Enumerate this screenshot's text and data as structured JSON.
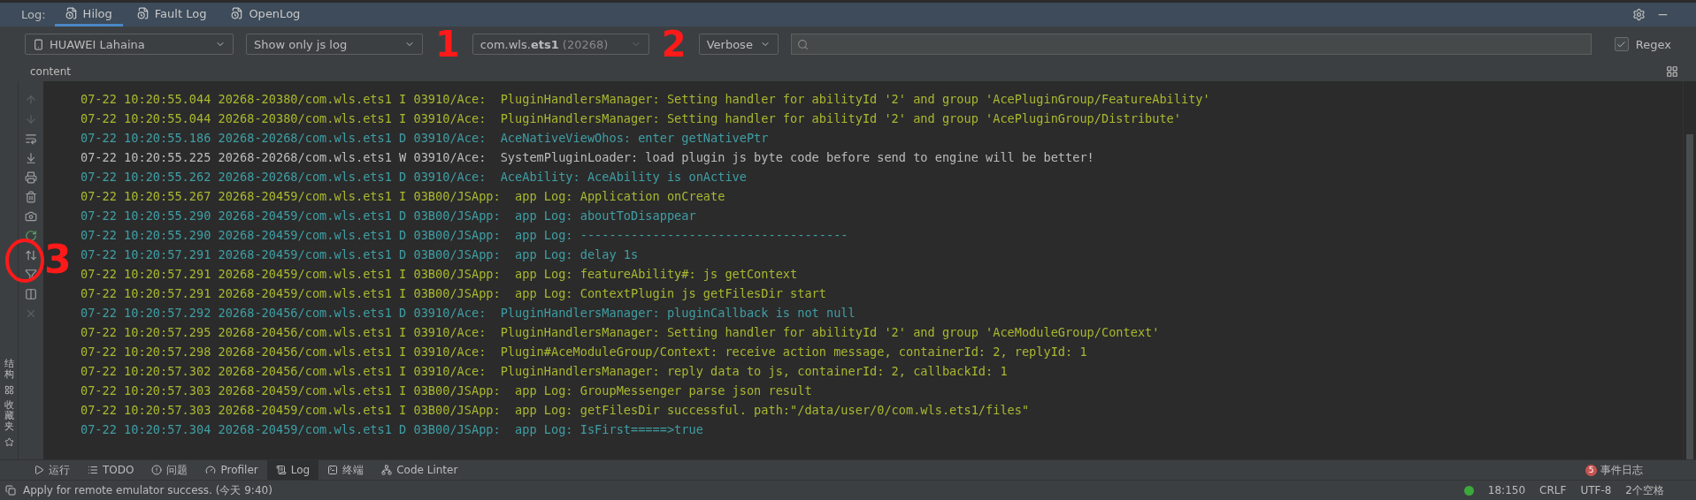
{
  "log_tabs": {
    "label": "Log:",
    "tabs": [
      {
        "label": "Hilog",
        "selected": true
      },
      {
        "label": "Fault Log",
        "selected": false
      },
      {
        "label": "OpenLog",
        "selected": false
      }
    ]
  },
  "filters": {
    "device": "HUAWEI Lahaina",
    "log_filter": "Show only js log",
    "process": {
      "name": "com.wls.",
      "name_bold": "ets1",
      "pid": "(20268)"
    },
    "level": "Verbose",
    "regex": {
      "label": "Regex",
      "checked": true
    }
  },
  "content_header": "content",
  "log_lines": [
    {
      "kind": "info",
      "text": "07-22 10:20:55.044 20268-20380/com.wls.ets1 I 03910/Ace:  PluginHandlersManager: Setting handler for abilityId '2' and group 'AcePluginGroup/FeatureAbility'"
    },
    {
      "kind": "info",
      "text": "07-22 10:20:55.044 20268-20380/com.wls.ets1 I 03910/Ace:  PluginHandlersManager: Setting handler for abilityId '2' and group 'AcePluginGroup/Distribute'"
    },
    {
      "kind": "debug",
      "text": "07-22 10:20:55.186 20268-20268/com.wls.ets1 D 03910/Ace:  AceNativeViewOhos: enter getNativePtr"
    },
    {
      "kind": "warn",
      "text": "07-22 10:20:55.225 20268-20268/com.wls.ets1 W 03910/Ace:  SystemPluginLoader: load plugin js byte code before send to engine will be better!"
    },
    {
      "kind": "debug",
      "text": "07-22 10:20:55.262 20268-20268/com.wls.ets1 D 03910/Ace:  AceAbility: AceAbility is onActive"
    },
    {
      "kind": "info",
      "text": "07-22 10:20:55.267 20268-20459/com.wls.ets1 I 03B00/JSApp:  app Log: Application onCreate"
    },
    {
      "kind": "debug",
      "text": "07-22 10:20:55.290 20268-20459/com.wls.ets1 D 03B00/JSApp:  app Log: aboutToDisappear"
    },
    {
      "kind": "debug",
      "text": "07-22 10:20:55.290 20268-20459/com.wls.ets1 D 03B00/JSApp:  app Log: -------------------------------------"
    },
    {
      "kind": "debug",
      "text": "07-22 10:20:57.291 20268-20459/com.wls.ets1 D 03B00/JSApp:  app Log: delay 1s"
    },
    {
      "kind": "info",
      "text": "07-22 10:20:57.291 20268-20459/com.wls.ets1 I 03B00/JSApp:  app Log: featureAbility#: js getContext"
    },
    {
      "kind": "info",
      "text": "07-22 10:20:57.291 20268-20459/com.wls.ets1 I 03B00/JSApp:  app Log: ContextPlugin js getFilesDir start"
    },
    {
      "kind": "debug",
      "text": "07-22 10:20:57.292 20268-20456/com.wls.ets1 D 03910/Ace:  PluginHandlersManager: pluginCallback is not null"
    },
    {
      "kind": "info",
      "text": "07-22 10:20:57.295 20268-20456/com.wls.ets1 I 03910/Ace:  PluginHandlersManager: Setting handler for abilityId '2' and group 'AceModuleGroup/Context'"
    },
    {
      "kind": "info",
      "text": "07-22 10:20:57.298 20268-20456/com.wls.ets1 I 03910/Ace:  Plugin#AceModuleGroup/Context: receive action message, containerId: 2, replyId: 1"
    },
    {
      "kind": "info",
      "text": "07-22 10:20:57.302 20268-20456/com.wls.ets1 I 03910/Ace:  PluginHandlersManager: reply data to js, containerId: 2, callbackId: 1"
    },
    {
      "kind": "info",
      "text": "07-22 10:20:57.303 20268-20459/com.wls.ets1 I 03B00/JSApp:  app Log: GroupMessenger parse json result"
    },
    {
      "kind": "info",
      "text": "07-22 10:20:57.303 20268-20459/com.wls.ets1 I 03B00/JSApp:  app Log: getFilesDir successful. path:\"/data/user/0/com.wls.ets1/files\""
    },
    {
      "kind": "debug",
      "text": "07-22 10:20:57.304 20268-20459/com.wls.ets1 D 03B00/JSApp:  app Log: IsFirst=====>true"
    }
  ],
  "side_tools": [
    {
      "label": "结构"
    },
    {
      "label": "收藏夹"
    }
  ],
  "bottom_tabs": [
    {
      "label": "运行",
      "selected": false
    },
    {
      "label": "TODO",
      "selected": false
    },
    {
      "label": "问题",
      "selected": false
    },
    {
      "label": "Profiler",
      "selected": false
    },
    {
      "label": "Log",
      "selected": true
    },
    {
      "label": "终端",
      "selected": false
    },
    {
      "label": "Code Linter",
      "selected": false
    }
  ],
  "event_log": {
    "label": "事件日志",
    "count": "5"
  },
  "status_bar": {
    "message": "Apply for remote emulator success. (今天 9:40)",
    "items": [
      "18:150",
      "CRLF",
      "UTF-8",
      "2个空格"
    ]
  },
  "annotations": [
    "1",
    "2",
    "3"
  ]
}
